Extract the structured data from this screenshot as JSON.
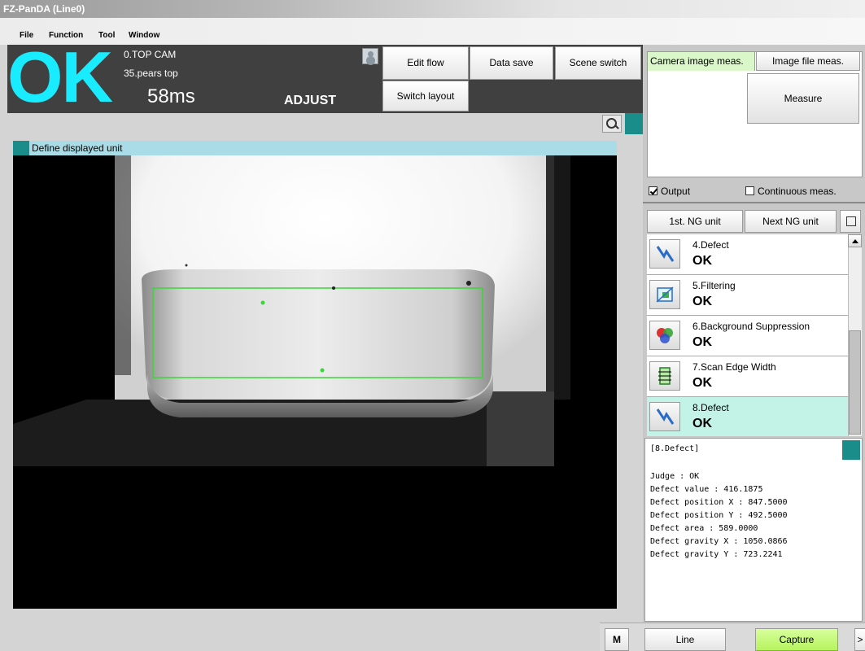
{
  "window": {
    "title": "FZ-PanDA (Line0)"
  },
  "menu": [
    "File",
    "Function",
    "Tool",
    "Window"
  ],
  "status": {
    "judge": "OK",
    "camera": "0.TOP CAM",
    "scene": "35.pears top",
    "time": "58ms",
    "mode": "ADJUST"
  },
  "toolbar": {
    "edit_flow": "Edit flow",
    "data_save": "Data save",
    "scene_switch": "Scene switch",
    "switch_layout": "Switch layout"
  },
  "image_panel": {
    "header": "Define displayed unit"
  },
  "measurement": {
    "tab_camera": "Camera image meas.",
    "tab_file": "Image file meas.",
    "measure_btn": "Measure",
    "output_label": "Output",
    "output_checked": true,
    "continuous_label": "Continuous meas.",
    "continuous_checked": false
  },
  "ng_nav": {
    "first": "1st. NG unit",
    "next": "Next NG unit"
  },
  "units": [
    {
      "name": "4.Defect",
      "result": "OK",
      "icon": "defect-icon"
    },
    {
      "name": "5.Filtering",
      "result": "OK",
      "icon": "filtering-icon"
    },
    {
      "name": "6.Background Suppression",
      "result": "OK",
      "icon": "background-suppression-icon"
    },
    {
      "name": "7.Scan Edge Width",
      "result": "OK",
      "icon": "scan-edge-width-icon"
    },
    {
      "name": "8.Defect",
      "result": "OK",
      "icon": "defect-icon",
      "selected": true
    }
  ],
  "detail": {
    "heading": "[8.Defect]",
    "lines": [
      "Judge : OK",
      "Defect value : 416.1875",
      "Defect position X : 847.5000",
      "Defect position Y : 492.5000",
      "Defect area : 589.0000",
      "Defect gravity X : 1050.0866",
      "Defect gravity Y : 723.2241"
    ]
  },
  "bottom": {
    "m": "M",
    "line": "Line",
    "capture": "Capture",
    "more": ">"
  },
  "colors": {
    "judge_ok": "#19ecff",
    "accent_teal": "#1a8c8a",
    "measure_region": "#38d838",
    "capture_green": "#b6f35e"
  }
}
